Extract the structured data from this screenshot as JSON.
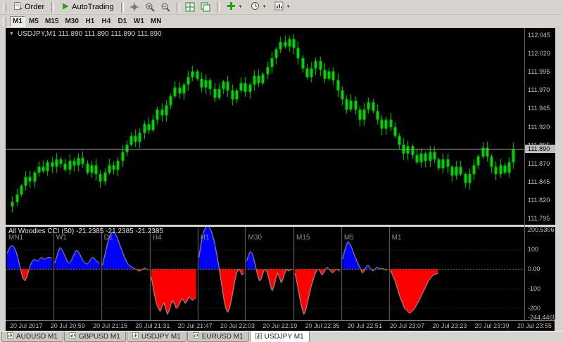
{
  "toolbar": {
    "order_label": "Order",
    "autotrading_label": "AutoTrading",
    "icons": [
      "order-icon",
      "autotrading-icon",
      "crosshair-icon",
      "zoom-in-icon",
      "zoom-out-icon",
      "tile-windows-icon",
      "cascade-windows-icon",
      "indicators-icon",
      "periods-icon",
      "templates-icon"
    ],
    "timeframes": [
      {
        "label": "M1",
        "active": true
      },
      {
        "label": "M5",
        "active": false
      },
      {
        "label": "M15",
        "active": false
      },
      {
        "label": "M30",
        "active": false
      },
      {
        "label": "H1",
        "active": false
      },
      {
        "label": "H4",
        "active": false
      },
      {
        "label": "D1",
        "active": false
      },
      {
        "label": "W1",
        "active": false
      },
      {
        "label": "MN",
        "active": false
      }
    ]
  },
  "chart": {
    "title": "USDJPY,M1 111.890 111.890 111.890 111.890",
    "current_price": "111.890",
    "price_axis": [
      "112.045",
      "112.020",
      "111.995",
      "111.970",
      "111.945",
      "111.920",
      "111.895",
      "111.870",
      "111.845",
      "111.820",
      "111.795"
    ]
  },
  "indicator": {
    "title": "All Woodies CCI (50) -21.2385 -21.2385 -21.2385",
    "axis_labels": [
      "200.5306",
      "100",
      "0.00",
      "-100",
      "-200",
      "-244.4465"
    ]
  },
  "time_axis": [
    "20 Jul 2017",
    "20 Jul 20:59",
    "20 Jul 21:15",
    "20 Jul 21:31",
    "20 Jul 21:47",
    "20 Jul 22:03",
    "20 Jul 22:19",
    "20 Jul 22:35",
    "20 Jul 22:51",
    "20 Jul 23:07",
    "20 Jul 23:23",
    "20 Jul 23:39",
    "20 Jul 23:55"
  ],
  "tabs": [
    {
      "label": "AUDUSD M1",
      "active": false
    },
    {
      "label": "GBPUSD M1",
      "active": false
    },
    {
      "label": "USDJPY M1",
      "active": false
    },
    {
      "label": "EURUSD M1",
      "active": false
    },
    {
      "label": "USDJPY M1",
      "active": true
    }
  ],
  "chart_data": [
    {
      "type": "candlestick",
      "symbol": "USDJPY",
      "period": "M1",
      "up_color": "#00dc00",
      "price_top": 112.055,
      "price_bottom": 111.787,
      "closes": [
        111.818,
        111.828,
        111.84,
        111.852,
        111.846,
        111.858,
        111.866,
        111.86,
        111.872,
        111.866,
        111.876,
        111.87,
        111.862,
        111.874,
        111.868,
        111.878,
        111.87,
        111.858,
        111.868,
        111.856,
        111.846,
        111.858,
        111.868,
        111.862,
        111.874,
        111.886,
        111.896,
        111.908,
        111.9,
        111.912,
        111.924,
        111.916,
        111.93,
        111.944,
        111.936,
        111.95,
        111.962,
        111.974,
        111.966,
        111.978,
        111.988,
        111.996,
        111.986,
        111.974,
        111.984,
        111.972,
        111.96,
        111.972,
        111.982,
        111.97,
        111.958,
        111.97,
        111.98,
        111.968,
        111.978,
        111.99,
        111.98,
        111.992,
        112.002,
        112.014,
        112.026,
        112.036,
        112.03,
        112.04,
        112.028,
        112.014,
        112.0,
        111.988,
        112.0,
        112.01,
        111.998,
        111.986,
        111.996,
        111.984,
        111.97,
        111.958,
        111.944,
        111.956,
        111.944,
        111.93,
        111.944,
        111.954,
        111.942,
        111.93,
        111.918,
        111.93,
        111.92,
        111.908,
        111.896,
        111.884,
        111.894,
        111.882,
        111.872,
        111.884,
        111.874,
        111.886,
        111.876,
        111.864,
        111.876,
        111.866,
        111.854,
        111.866,
        111.856,
        111.844,
        111.856,
        111.868,
        111.88,
        111.892,
        111.88,
        111.866,
        111.856,
        111.868,
        111.858,
        111.872,
        111.89
      ]
    },
    {
      "type": "cci_panels",
      "name": "All Woodies CCI (50)",
      "current_value": -21.2385,
      "pos_color": "#0000ff",
      "neg_color": "#ff0000",
      "vmax": 215,
      "vmin": -260,
      "bounds": [
        0,
        0.092,
        0.184,
        0.278,
        0.37,
        0.462,
        0.555,
        0.647,
        0.739,
        1.0
      ],
      "panels": [
        {
          "label": "MN1",
          "values": [
            80,
            100,
            115,
            120,
            110,
            90,
            60,
            20,
            -20,
            -50,
            -60,
            -40,
            -10,
            20,
            40,
            50,
            45,
            40,
            50,
            60,
            55,
            50,
            55,
            60,
            58,
            55
          ]
        },
        {
          "label": "W1",
          "values": [
            30,
            60,
            90,
            110,
            100,
            80,
            60,
            40,
            30,
            40,
            60,
            80,
            95,
            90,
            75,
            55,
            40,
            30,
            25,
            35,
            50,
            60,
            55,
            45,
            35,
            30
          ]
        },
        {
          "label": "D1",
          "values": [
            20,
            60,
            100,
            140,
            170,
            185,
            190,
            180,
            160,
            135,
            110,
            85,
            60,
            40,
            25,
            15,
            10,
            5,
            0,
            -5,
            -10,
            -5,
            0,
            5,
            0,
            -5
          ]
        },
        {
          "label": "H4",
          "values": [
            -40,
            -90,
            -140,
            -180,
            -200,
            -215,
            -190,
            -170,
            -200,
            -230,
            -210,
            -180,
            -160,
            -180,
            -200,
            -190,
            -170,
            -150,
            -160,
            -175,
            -160,
            -140,
            -150,
            -160,
            -150,
            -145
          ]
        },
        {
          "label": "H1",
          "values": [
            60,
            120,
            170,
            200,
            215,
            220,
            210,
            190,
            160,
            120,
            70,
            20,
            -40,
            -100,
            -160,
            -200,
            -220,
            -200,
            -160,
            -110,
            -60,
            -20,
            0,
            -10,
            -30,
            -20
          ]
        },
        {
          "label": "M30",
          "values": [
            40,
            70,
            90,
            80,
            50,
            10,
            -30,
            -60,
            -50,
            -20,
            0,
            -10,
            -40,
            -80,
            -110,
            -90,
            -50,
            -20,
            -40,
            -70,
            -50,
            -20,
            0,
            -10,
            -5,
            0
          ]
        },
        {
          "label": "M15",
          "values": [
            -20,
            -60,
            -110,
            -160,
            -200,
            -230,
            -210,
            -170,
            -130,
            -90,
            -60,
            -30,
            -10,
            0,
            -10,
            -30,
            -20,
            0,
            10,
            0,
            -10,
            -20,
            -10,
            0,
            -5,
            -10
          ]
        },
        {
          "label": "M5",
          "values": [
            50,
            90,
            120,
            140,
            130,
            110,
            85,
            60,
            40,
            20,
            0,
            -20,
            -10,
            10,
            20,
            10,
            0,
            -10,
            0,
            10,
            5,
            0,
            5,
            0,
            -5,
            0
          ]
        },
        {
          "label": "M1",
          "span": 0.36,
          "values": [
            -5,
            -60,
            -140,
            -200,
            -225,
            -205,
            -160,
            -110,
            -60,
            -30,
            -21
          ]
        }
      ]
    }
  ]
}
